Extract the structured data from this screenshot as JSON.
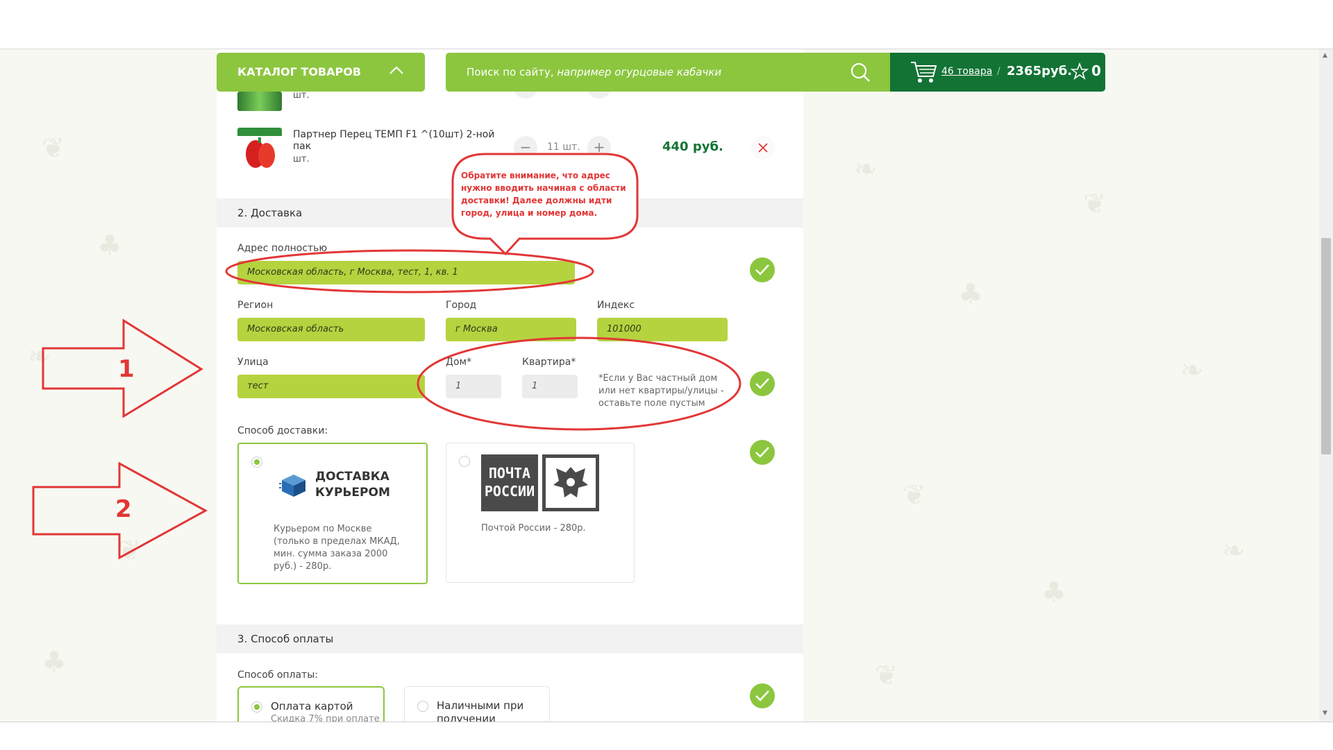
{
  "header": {
    "catalog_label": "КАТАЛОГ ТОВАРОВ",
    "search_placeholder_lead": "Поиск по сайту, ",
    "search_placeholder_example": "например огурцовые кабачки",
    "cart_count": "46 товара",
    "cart_sep": "/",
    "cart_total": "2365руб.",
    "favorites_count": "0"
  },
  "cart_items": {
    "partial_unit": "шт.",
    "item": {
      "name": "Партнер Перец ТЕМП F1 ^(10шт) 2-ной пак",
      "unit": "шт.",
      "qty": "11",
      "qty_unit": "шт.",
      "price": "440 руб.",
      "minus": "−",
      "plus": "+"
    }
  },
  "delivery": {
    "section_title": "2. Доставка",
    "full_address_label": "Адрес полностью",
    "full_address_value": "Московская область, г Москва, тест, 1, кв. 1",
    "region_label": "Регион",
    "region_value": "Московская область",
    "city_label": "Город",
    "city_value": "г Москва",
    "zip_label": "Индекс",
    "zip_value": "101000",
    "street_label": "Улица",
    "street_value": "тест",
    "house_label": "Дом*",
    "house_value": "1",
    "apt_label": "Квартира*",
    "apt_value": "1",
    "note": "*Если у Вас частный дом или нет квартиры/улицы - оставьте поле пустым",
    "method_label": "Способ доставки:",
    "methods": [
      {
        "title_line1": "ДОСТАВКА",
        "title_line2": "КУРЬЕРОМ",
        "desc": "Курьером по Москве (только в пределах МКАД, мин. сумма заказа 2000 руб.) - 280р.",
        "selected": true
      },
      {
        "logo_line1": "ПОЧТА",
        "logo_line2": "РОССИИ",
        "desc": "Почтой России - 280р.",
        "selected": false
      }
    ]
  },
  "payment": {
    "section_title": "3. Способ оплаты",
    "method_label": "Способ оплаты:",
    "methods": [
      {
        "title": "Оплата картой",
        "sub": "Скидка 7% при оплате",
        "selected": true
      },
      {
        "title": "Наличными при получении",
        "selected": false
      }
    ]
  },
  "annotations": {
    "bubble": "Обратите внимание, что адрес нужно вводить начиная с области доставки! Далее должны идти город, улица и номер дома.",
    "arrow1": "1",
    "arrow2": "2"
  },
  "colors": {
    "accent_green": "#8cc63f",
    "dark_green": "#137335",
    "annotation_red": "#e23636"
  }
}
